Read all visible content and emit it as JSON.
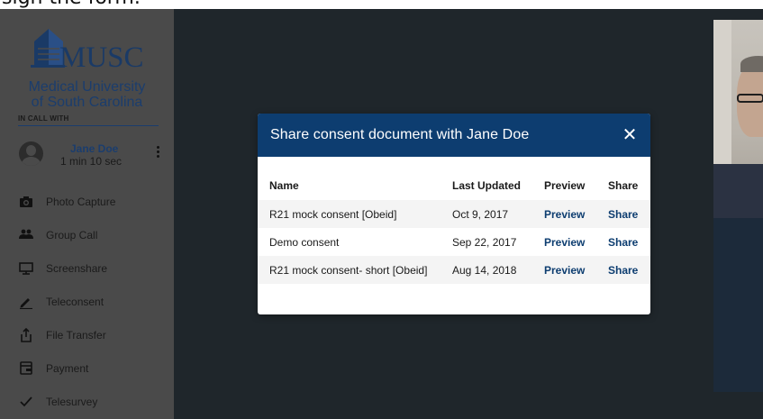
{
  "caption": "sign the form.",
  "sidebar": {
    "logo": {
      "word": "MUSC",
      "line1": "Medical University",
      "line2": "of South Carolina"
    },
    "in_call_label": "IN CALL WITH",
    "caller": {
      "name": "Jane Doe",
      "duration": "1 min 10 sec"
    },
    "menu": [
      {
        "label": "Photo Capture",
        "icon": "camera-icon"
      },
      {
        "label": "Group Call",
        "icon": "group-icon"
      },
      {
        "label": "Screenshare",
        "icon": "monitor-icon"
      },
      {
        "label": "Teleconsent",
        "icon": "pen-icon"
      },
      {
        "label": "File Transfer",
        "icon": "upload-icon"
      },
      {
        "label": "Payment",
        "icon": "wallet-icon"
      },
      {
        "label": "Telesurvey",
        "icon": "check-icon"
      }
    ]
  },
  "modal": {
    "title": "Share consent document with Jane Doe",
    "close": "✕",
    "columns": {
      "name": "Name",
      "updated": "Last Updated",
      "preview": "Preview",
      "share": "Share"
    },
    "rows": [
      {
        "name": "R21 mock consent [Obeid]",
        "updated": "Oct 9, 2017",
        "preview": "Preview",
        "share": "Share"
      },
      {
        "name": "Demo consent",
        "updated": "Sep 22, 2017",
        "preview": "Preview",
        "share": "Share"
      },
      {
        "name": "R21 mock consent- short [Obeid]",
        "updated": "Aug 14, 2018",
        "preview": "Preview",
        "share": "Share"
      }
    ]
  },
  "colors": {
    "brand_navy": "#0d3d70",
    "sidebar_bg": "#4a4a4a",
    "app_bg": "#1f262b"
  }
}
